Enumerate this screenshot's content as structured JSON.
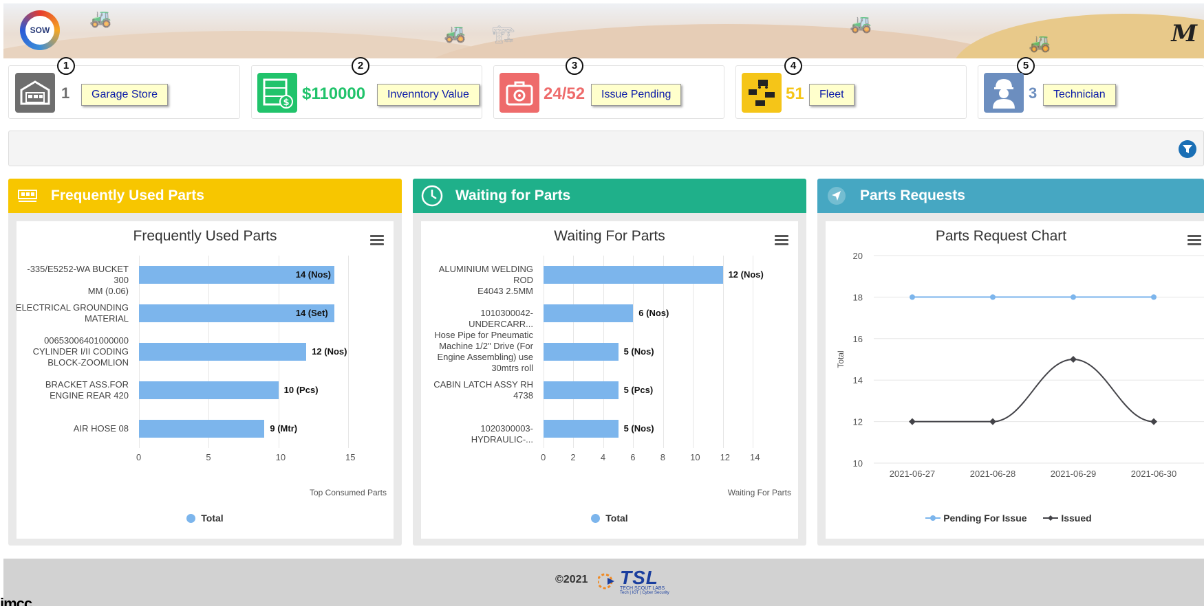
{
  "header": {
    "logo_text": "SOW",
    "brand_mark": "M"
  },
  "kpis": [
    {
      "number": "1",
      "value": "1",
      "label": "Garage Store",
      "color": "#6e6e6e",
      "icon": "warehouse-icon"
    },
    {
      "number": "2",
      "value": "$110000",
      "label": "Invenntory Value",
      "color": "#21c36b",
      "icon": "shelves-dollar-icon"
    },
    {
      "number": "3",
      "value": "24/52",
      "label": "Issue Pending",
      "color": "#ee6b6b",
      "icon": "toolbox-gear-icon"
    },
    {
      "number": "4",
      "value": "51",
      "label": "Fleet",
      "color": "#f5c518",
      "icon": "vehicles-icon"
    },
    {
      "number": "5",
      "value": "3",
      "label": "Technician",
      "color": "#6c8ebf",
      "icon": "technician-icon"
    }
  ],
  "filter": {
    "icon": "filter-icon"
  },
  "panels": {
    "frequent": {
      "title": "Frequently Used Parts",
      "color": "#f7c600"
    },
    "waiting": {
      "title": "Waiting for Parts",
      "color": "#1fb08a"
    },
    "requests": {
      "title": "Parts Requests",
      "color": "#46a7c2"
    }
  },
  "chart_data": [
    {
      "type": "bar",
      "orientation": "horizontal",
      "title": "Frequently Used Parts",
      "xlabel": "Top Consumed Parts",
      "xlim": [
        0,
        15
      ],
      "xticks": [
        "0",
        "5",
        "10",
        "15"
      ],
      "categories": [
        [
          "-335/E5252-WA BUCKET 300",
          "MM (0.06)"
        ],
        [
          "ELECTRICAL GROUNDING",
          "MATERIAL"
        ],
        [
          "00653006401000000",
          "CYLINDER I/II CODING",
          "BLOCK-ZOOMLION"
        ],
        [
          "BRACKET ASS.FOR",
          "ENGINE REAR 420"
        ],
        [
          "AIR HOSE 08"
        ]
      ],
      "values": [
        14,
        14,
        12,
        10,
        9
      ],
      "data_labels": [
        "14 (Nos)",
        "14 (Set)",
        "12 (Nos)",
        "10 (Pcs)",
        "9 (Mtr)"
      ],
      "legend": "Total"
    },
    {
      "type": "bar",
      "orientation": "horizontal",
      "title": "Waiting For Parts",
      "xlabel": "Waiting For Parts",
      "xlim": [
        0,
        14
      ],
      "xticks": [
        "0",
        "2",
        "4",
        "6",
        "8",
        "10",
        "12",
        "14"
      ],
      "categories": [
        [
          "ALUMINIUM WELDING ROD",
          "E4043 2.5MM"
        ],
        [
          "1010300042-UNDERCARR..."
        ],
        [
          "Hose Pipe for Pneumatic",
          "Machine 1/2\" Drive (For",
          "Engine Assembling) use",
          "30mtrs roll"
        ],
        [
          "CABIN LATCH ASSY RH",
          "4738"
        ],
        [
          "1020300003-HYDRAULIC-..."
        ]
      ],
      "values": [
        12,
        6,
        5,
        5,
        5
      ],
      "data_labels": [
        "12 (Nos)",
        "6 (Nos)",
        "5 (Nos)",
        "5 (Pcs)",
        "5 (Nos)"
      ],
      "legend": "Total"
    },
    {
      "type": "line",
      "title": "Parts Request Chart",
      "ylabel": "Total",
      "ylim": [
        10,
        20
      ],
      "yticks": [
        "10",
        "12",
        "14",
        "16",
        "18",
        "20"
      ],
      "x": [
        "2021-06-27",
        "2021-06-28",
        "2021-06-29",
        "2021-06-30"
      ],
      "series": [
        {
          "name": "Pending For Issue",
          "values": [
            18,
            18,
            18,
            18
          ],
          "color": "#7cb5ec"
        },
        {
          "name": "Issued",
          "values": [
            12,
            12,
            15,
            12
          ],
          "color": "#434348"
        }
      ]
    }
  ],
  "footer": {
    "copyright": "©2021",
    "brand": "TSL",
    "brand_sub": "TECH SCOUT LABS",
    "brand_tag": "Tech | IOT | Cyber Security"
  },
  "corner_text": "imcc"
}
